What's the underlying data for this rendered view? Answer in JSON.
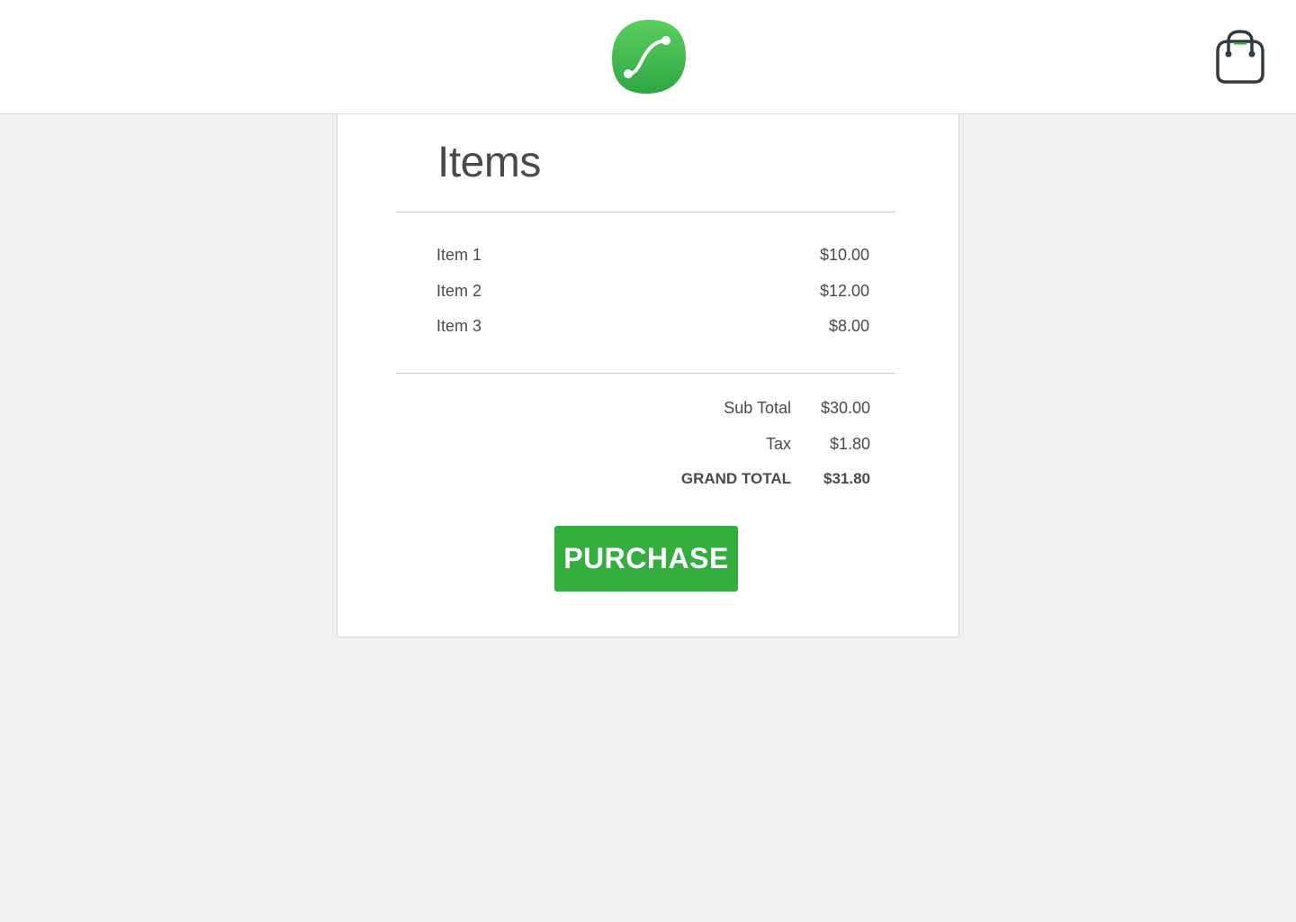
{
  "header": {
    "logo_icon": "leaf-route-logo-icon",
    "cart_icon": "shopping-bag-icon"
  },
  "colors": {
    "accent": "#34ad3f",
    "logo_gradient_top": "#5bce5f",
    "logo_gradient_bottom": "#2fa744",
    "text": "#4a4a4a",
    "background": "#f0f0f0"
  },
  "cart": {
    "title": "Items",
    "items": [
      {
        "name": "Item 1",
        "price": "$10.00"
      },
      {
        "name": "Item 2",
        "price": "$12.00"
      },
      {
        "name": "Item 3",
        "price": "$8.00"
      }
    ],
    "subtotal": {
      "label": "Sub Total",
      "value": "$30.00"
    },
    "tax": {
      "label": "Tax",
      "value": "$1.80"
    },
    "grand_total": {
      "label": "GRAND TOTAL",
      "value": "$31.80"
    },
    "purchase_label": "PURCHASE"
  }
}
